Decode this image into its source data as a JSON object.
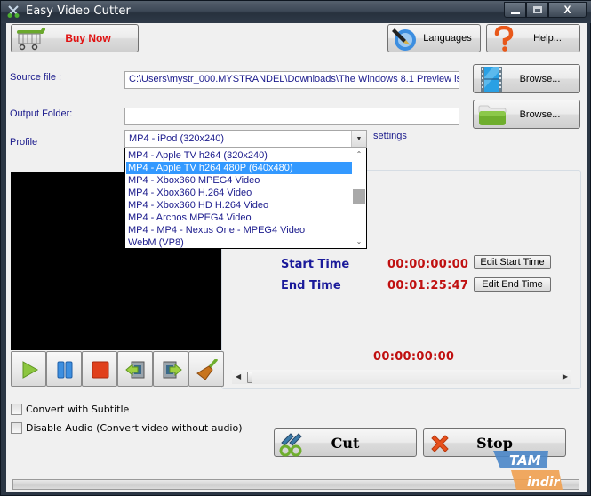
{
  "window": {
    "title": "Easy Video Cutter",
    "controls": {
      "minimize": "minimize",
      "maximize": "maximize",
      "close": "X"
    }
  },
  "toolbar": {
    "buy_now_label": "Buy Now",
    "languages_label": "Languages",
    "help_label": "Help..."
  },
  "source": {
    "label": "Source file :",
    "value": "C:\\Users\\mystr_000.MYSTRANDEL\\Downloads\\The Windows 8.1 Preview is",
    "browse_label": "Browse..."
  },
  "output": {
    "label": "Output Folder:",
    "value": "",
    "browse_label": "Browse..."
  },
  "profile": {
    "label": "Profile",
    "selected": "MP4 - iPod (320x240)",
    "settings_link": "settings",
    "options": [
      "MP4 - Apple TV h264 (320x240)",
      "MP4 - Apple TV h264 480P (640x480)",
      "MP4 - Xbox360 MPEG4 Video",
      "MP4 - Xbox360 H.264 Video",
      "MP4 - Xbox360 HD H.264 Video",
      "MP4 - Archos MPEG4 Video",
      "MP4 - MP4 - Nexus One - MPEG4 Video",
      "WebM (VP8)"
    ],
    "highlighted_index": 1
  },
  "timing": {
    "start_label": "Start Time",
    "start_value": "00:00:00:00",
    "edit_start_label": "Edit Start Time",
    "end_label": "End Time",
    "end_value": "00:01:25:47",
    "edit_end_label": "Edit End Time",
    "current_position": "00:00:00:00",
    "slider_position": 0.0
  },
  "player": {
    "buttons": [
      "play",
      "pause",
      "stop",
      "set-start",
      "set-end",
      "clear"
    ]
  },
  "options": {
    "subtitle_label": "Convert with Subtitle",
    "subtitle_checked": false,
    "disable_audio_label": "Disable Audio (Convert video without audio)",
    "disable_audio_checked": false
  },
  "actions": {
    "cut_label": "Cut",
    "stop_label": "Stop"
  },
  "progress": {
    "value": 0
  },
  "watermark": {
    "top": "TAM",
    "bottom": "indir"
  },
  "colors": {
    "label_blue": "#1a1a8c",
    "time_red": "#c01010",
    "selection_blue": "#3399ff",
    "buy_now_red": "#e01010"
  }
}
